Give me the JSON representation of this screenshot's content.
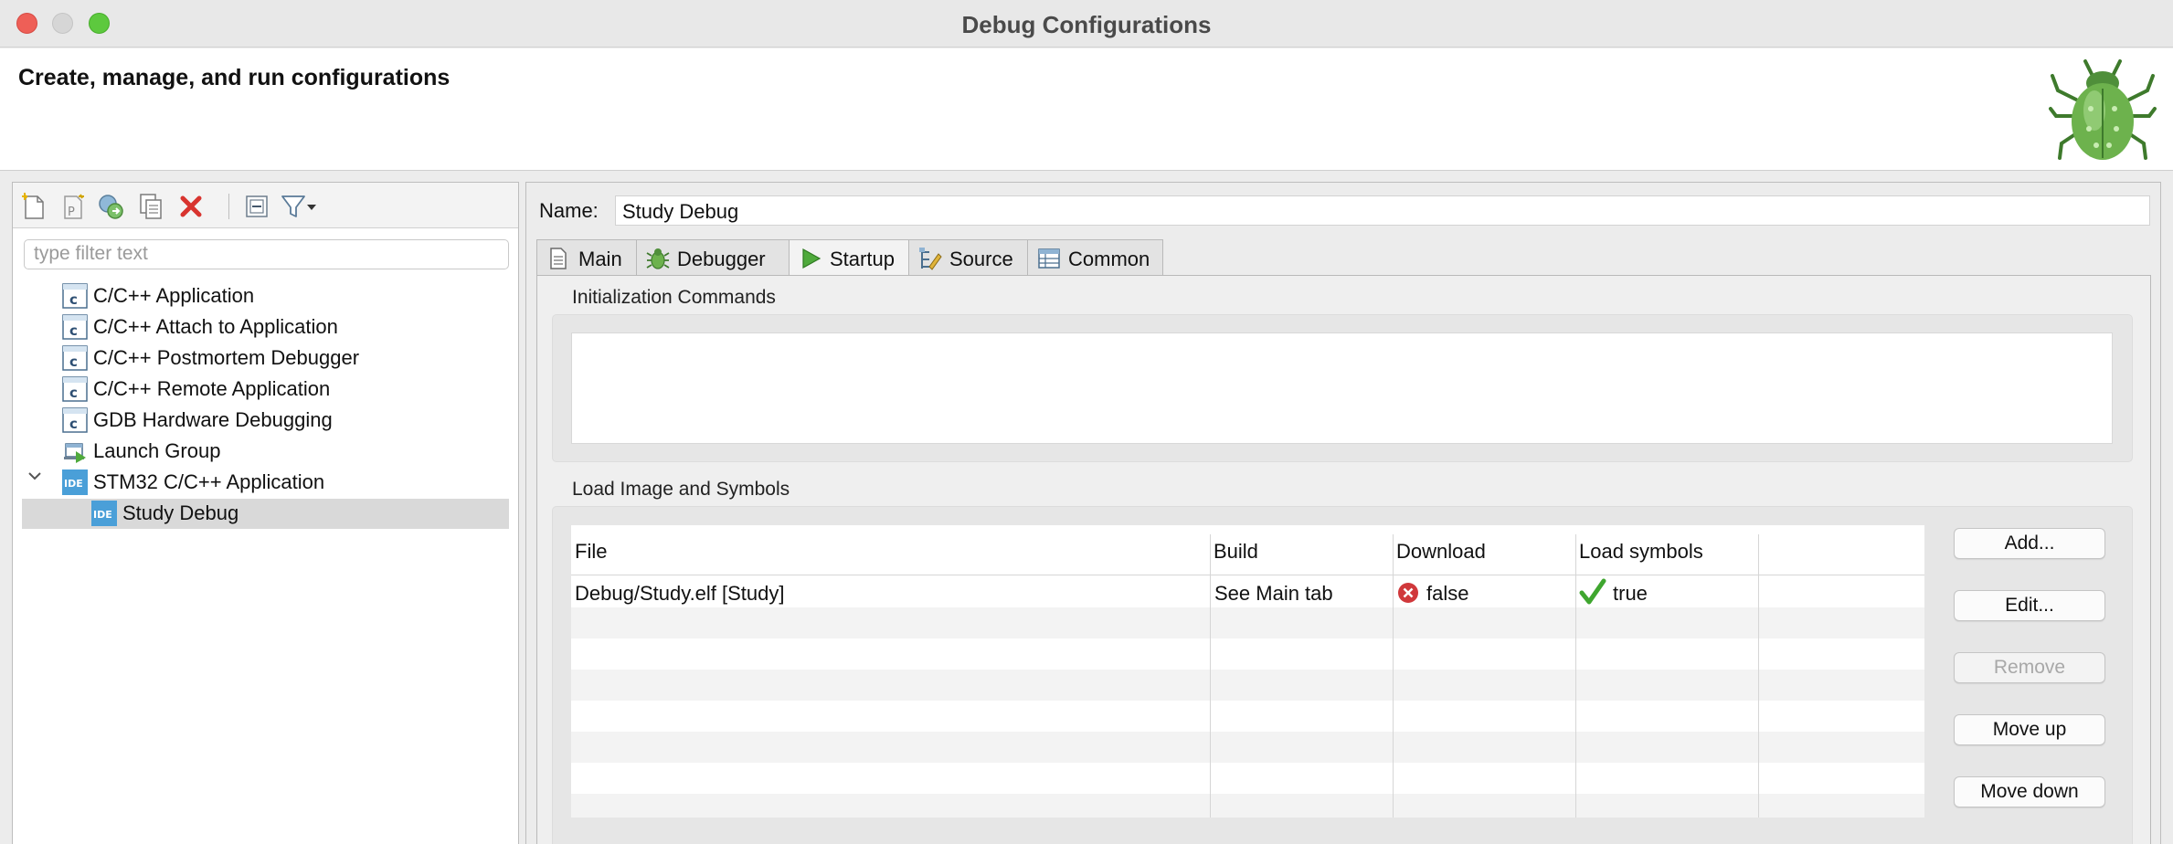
{
  "window": {
    "title": "Debug Configurations"
  },
  "header": {
    "text": "Create, manage, and run configurations"
  },
  "toolbar": {
    "icons": [
      "new-config-icon",
      "new-prototype-icon",
      "export-icon",
      "duplicate-icon",
      "delete-icon",
      "collapse-all-icon",
      "filter-icon",
      "dropdown-arrow-icon"
    ]
  },
  "filter": {
    "placeholder": "type filter text"
  },
  "tree": {
    "items": [
      {
        "label": "C/C++ Application"
      },
      {
        "label": "C/C++ Attach to Application"
      },
      {
        "label": "C/C++ Postmortem Debugger"
      },
      {
        "label": "C/C++ Remote Application"
      },
      {
        "label": "GDB Hardware Debugging"
      },
      {
        "label": "Launch Group"
      },
      {
        "label": "STM32 C/C++ Application"
      },
      {
        "label": "Study Debug"
      }
    ],
    "ide_badge": "IDE",
    "c_badge": "c"
  },
  "config": {
    "name_label": "Name:",
    "name_value": "Study Debug",
    "tabs": [
      {
        "label": "Main"
      },
      {
        "label": "Debugger"
      },
      {
        "label": "Startup"
      },
      {
        "label": "Source"
      },
      {
        "label": "Common"
      }
    ],
    "active_tab": "Startup",
    "init_label": "Initialization Commands",
    "load_label": "Load Image and Symbols",
    "table": {
      "headers": [
        "File",
        "Build",
        "Download",
        "Load symbols"
      ],
      "rows": [
        {
          "file": "Debug/Study.elf [Study]",
          "build": "See Main tab",
          "download": "false",
          "load_symbols": "true"
        }
      ]
    },
    "buttons": {
      "add": "Add...",
      "edit": "Edit...",
      "remove": "Remove",
      "move_up": "Move up",
      "move_down": "Move down"
    }
  },
  "colors": {
    "close": "#ee5f57",
    "maximize": "#5dc93e",
    "ide_blue": "#4a9fd8",
    "selection": "#d9d9d9",
    "error_red": "#d0383b",
    "check_green": "#3fa62f"
  }
}
